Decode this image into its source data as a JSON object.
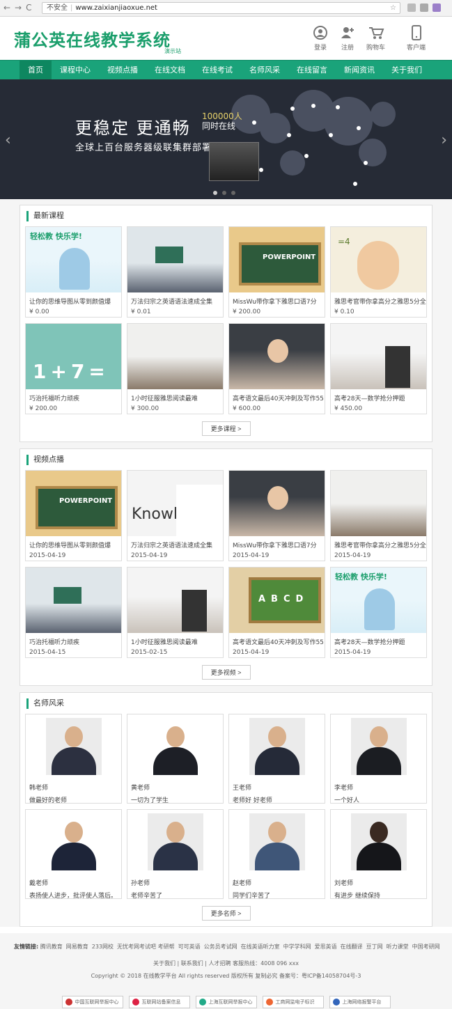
{
  "browser": {
    "security": "不安全",
    "url": "www.zaixianjiaoxue.net"
  },
  "header": {
    "logo": "蒲公英在线教学系统",
    "logo_sub": "演示站",
    "icons": [
      {
        "label": "登录",
        "icon": "user-circle-icon"
      },
      {
        "label": "注册",
        "icon": "add-user-icon"
      },
      {
        "label": "购物车",
        "icon": "cart-icon"
      },
      {
        "label": "客户端",
        "icon": "phone-icon"
      }
    ]
  },
  "nav": [
    "首页",
    "课程中心",
    "视频点播",
    "在线文档",
    "在线考试",
    "名师风采",
    "在线留言",
    "新闻资讯",
    "关于我们"
  ],
  "banner": {
    "line1": "更稳定  更通畅",
    "line2": "全球上百台服务器级联集群部署",
    "count": "100000人",
    "count_sub": "同时在线"
  },
  "courses": {
    "title": "最新课程",
    "more": "更多课程 >",
    "items": [
      {
        "name": "让你的思维导图从零到颜值爆",
        "price": "¥ 0.00"
      },
      {
        "name": "万法归宗之英语语法速成全集",
        "price": "¥ 0.01"
      },
      {
        "name": "MissWu带你拿下雅思口语7分",
        "price": "¥ 200.00"
      },
      {
        "name": "雅思考官带你拿高分之雅思5分全",
        "price": "¥ 0.10"
      },
      {
        "name": "巧治托福听力顽疾",
        "price": "¥ 200.00"
      },
      {
        "name": "1小时征服雅思阅读最难",
        "price": "¥ 300.00"
      },
      {
        "name": "高考语文最后40天冲刺及写作55",
        "price": "¥ 600.00"
      },
      {
        "name": "高考28天—数学抢分押题",
        "price": "¥ 450.00"
      }
    ]
  },
  "videos": {
    "title": "视频点播",
    "more": "更多视频 >",
    "items": [
      {
        "name": "让你的思维导图从零到颜值爆",
        "date": "2015-04-19"
      },
      {
        "name": "万法归宗之英语语法速成全集",
        "date": "2015-04-19"
      },
      {
        "name": "MissWu带你拿下雅思口语7分",
        "date": "2015-04-19"
      },
      {
        "name": "雅思考官带你拿高分之雅思5分全",
        "date": "2015-04-19"
      },
      {
        "name": "巧治托福听力顽疾",
        "date": "2015-04-15"
      },
      {
        "name": "1小时征服雅思阅读最难",
        "date": "2015-02-15"
      },
      {
        "name": "高考语文最后40天冲刺及写作55",
        "date": "2015-04-19"
      },
      {
        "name": "高考28天—数学抢分押题",
        "date": "2015-04-19"
      }
    ]
  },
  "teachers": {
    "title": "名师风采",
    "more": "更多名师 >",
    "items": [
      {
        "name": "韩老师",
        "motto": "做最好的老师"
      },
      {
        "name": "黄老师",
        "motto": "一切为了学生"
      },
      {
        "name": "王老师",
        "motto": "老师好 好老师"
      },
      {
        "name": "李老师",
        "motto": "一个好人"
      },
      {
        "name": "戴老师",
        "motto": "表扬使人进步，批评使人落后。"
      },
      {
        "name": "孙老师",
        "motto": "老师辛苦了"
      },
      {
        "name": "赵老师",
        "motto": "同学们辛苦了"
      },
      {
        "name": "刘老师",
        "motto": "有进步 继续保持"
      }
    ]
  },
  "footer": {
    "links_label": "友情链接:",
    "links": [
      "腾讯教育",
      "网易教育",
      "233网校",
      "无忧考网考试吧 考研帮",
      "可可英语",
      "公务员考试网",
      "在线英语听力室",
      "中学学科网",
      "爱思英语",
      "在线翻译",
      "豆丁网",
      "听力课堂",
      "中国考研网"
    ],
    "line2": "关于我们 | 联系我们 | 人才招聘  客服热线：4008 096 xxx",
    "line3": "Copyright © 2018 在线教学平台 All rights reserved 版权所有 复制必究 备案号：粤ICP备14058704号-3",
    "badges": [
      "中国互联网举报中心",
      "互联网站备案信息",
      "上海互联网举报中心",
      "工商网监电子标识",
      "上海网络报警平台"
    ]
  }
}
